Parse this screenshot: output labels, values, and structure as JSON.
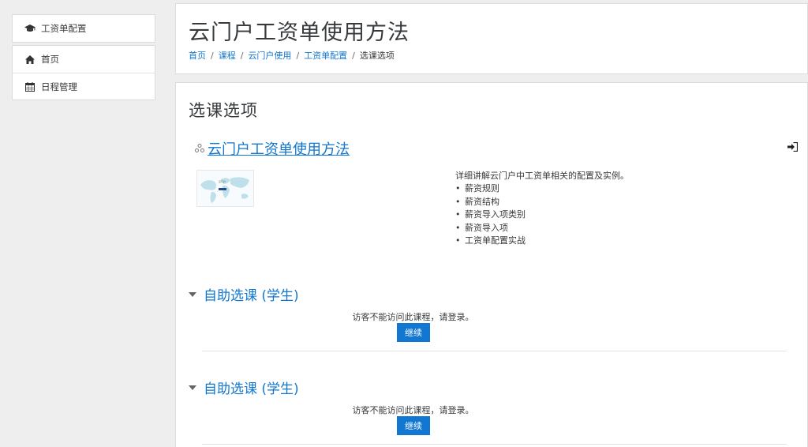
{
  "sidebar": {
    "card1": {
      "label": "工资单配置",
      "icon": "graduation-cap-icon"
    },
    "items": [
      {
        "label": "首页",
        "icon": "home-icon"
      },
      {
        "label": "日程管理",
        "icon": "calendar-icon"
      }
    ]
  },
  "header": {
    "title": "云门户工资单使用方法",
    "breadcrumb": [
      "首页",
      "课程",
      "云门户使用",
      "工资单配置"
    ],
    "breadcrumb_current": "选课选项"
  },
  "main": {
    "section_title": "选课选项",
    "course": {
      "name": "云门户工资单使用方法",
      "summary_intro": "详细讲解云门户中工资单相关的配置及实例。",
      "summary_items": [
        "薪资规则",
        "薪资结构",
        "薪资导入项类别",
        "薪资导入项",
        "工资单配置实战"
      ]
    },
    "enrol_methods": [
      {
        "title": "自助选课 (学生)",
        "message": "访客不能访问此课程，请登录。",
        "button": "继续"
      },
      {
        "title": "自助选课 (学生)",
        "message": "访客不能访问此课程，请登录。",
        "button": "继续"
      }
    ]
  },
  "colors": {
    "link": "#1177d1",
    "button": "#1177d1",
    "background": "#eeeeee"
  }
}
